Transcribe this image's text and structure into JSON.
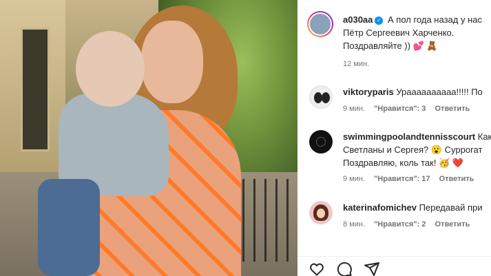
{
  "post": {
    "author": "a030aa",
    "caption_line1": "А пол года назад у нас",
    "caption_line2": "Пётр Сергеевич Харченко.",
    "caption_line3": "Поздравляйте ))",
    "caption_emoji": "💕 🧸",
    "time": "12 мин."
  },
  "comments": [
    {
      "user": "viktoryparis",
      "lines": [
        "Ураааааааааа!!!!! По"
      ],
      "time": "9 мин.",
      "likes": "\"Нравится\": 3",
      "reply": "Ответить"
    },
    {
      "user": "swimmingpoolandtennisscourt",
      "lines": [
        "Как",
        "Светланы и Сергея? 😮 Суррогат",
        "Поздравляю, коль так! 🥳 ❤️"
      ],
      "time": "9 мин.",
      "likes": "\"Нравится\": 17",
      "reply": "Ответить"
    },
    {
      "user": "katerinafomichev",
      "lines": [
        "Передавай при"
      ],
      "time": "8 мин.",
      "likes": "\"Нравится\": 2",
      "reply": "Ответить"
    }
  ],
  "icons": {
    "like": "heart-icon",
    "comment": "comment-icon",
    "share": "share-icon"
  },
  "colors": {
    "verified": "#0095f6",
    "text": "#262626",
    "meta": "#737373"
  }
}
